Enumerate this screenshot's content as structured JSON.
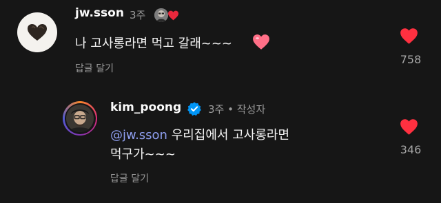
{
  "comments": [
    {
      "username": "jw.sson",
      "time": "3주",
      "text": "나 고사롱라면 먹고 갈래~~~",
      "reply_label": "답글 달기",
      "like_count": "758",
      "liked": true,
      "avatar_icon": "heart-shaped-object-avatar",
      "badge_icons": [
        "mini-avatar-icon",
        "red-heart-icon"
      ],
      "trailing_emoji": "pink-heart-emoji"
    },
    {
      "username": "kim_poong",
      "verified": true,
      "meta": "3주 • 작성자",
      "mention": "@jw.sson",
      "text_line1": " 우리집에서 고사롱라면",
      "text_line2": "먹구가~~~",
      "reply_label": "답글 달기",
      "like_count": "346",
      "liked": true,
      "avatar_icon": "profile-photo-avatar"
    }
  ],
  "colors": {
    "background": "#161616",
    "like_red": "#ff3040",
    "mention_blue": "#8f9ff0",
    "verified_blue": "#0095f6"
  }
}
